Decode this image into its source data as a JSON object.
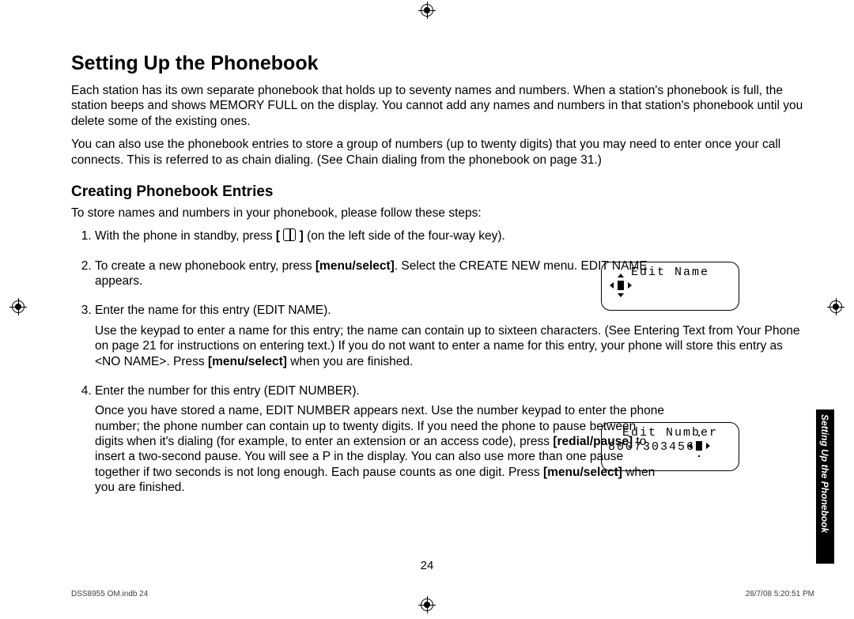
{
  "pageTitle": "Setting Up the Phonebook",
  "intro1": "Each station has its own separate phonebook that holds up to seventy names and numbers. When a station's phonebook is full, the station beeps and shows MEMORY FULL on the display. You cannot add any names and numbers in that station's phonebook until you delete some of the existing ones.",
  "intro2": "You can also use the phonebook entries to store a group of numbers (up to twenty digits) that you may need to enter once your call connects. This is referred to as chain dialing. (See Chain dialing from the phonebook on page 31.)",
  "subtitle": "Creating Phonebook Entries",
  "subintro": "To store names and numbers in your phonebook, please follow these steps:",
  "step1a": "With the phone in standby, press ",
  "step1b": "[ ",
  "step1c": " ]",
  "step1d": " (on the left side of the four-way key).",
  "step2a": "To create a new phonebook entry, press ",
  "step2b": "[menu/select]",
  "step2c": ". Select the CREATE NEW menu. EDIT NAME appears.",
  "step3a": "Enter the name for this entry (EDIT NAME).",
  "step3b_a": "Use the keypad to enter a name for this entry; the name can contain up to sixteen characters. (See Entering Text from Your Phone on page 21 for instructions on entering text.) If you do not want to enter a name for this entry, your phone will store this entry as <NO NAME>. Press ",
  "step3b_b": "[menu/select]",
  "step3b_c": " when you are finished.",
  "step4a": "Enter the number for this entry (EDIT NUMBER).",
  "step4b_a": "Once you have stored a name, EDIT NUMBER appears next. Use the number keypad to enter the phone number; the phone number can contain up to twenty digits. If you need the phone to pause between digits when it's dialing (for example, to enter an extension or an access code), press ",
  "step4b_b": "[redial/pause]",
  "step4b_c": " to insert a two-second pause. You will see a P in the display. You can also use more than one pause together if two seconds is not long enough. Each pause counts as one digit. Press ",
  "step4b_d": "[menu/select]",
  "step4b_e": " when you are finished.",
  "lcd1_line1": "Edit Name",
  "lcd2_line1": "Edit Number",
  "lcd2_line2": "8007303456",
  "sideTab": "Setting Up the Phonebook",
  "pageNum": "24",
  "footerLeft": "DSS8955 OM.indb   24",
  "footerRight": "28/7/08   5:20:51 PM"
}
